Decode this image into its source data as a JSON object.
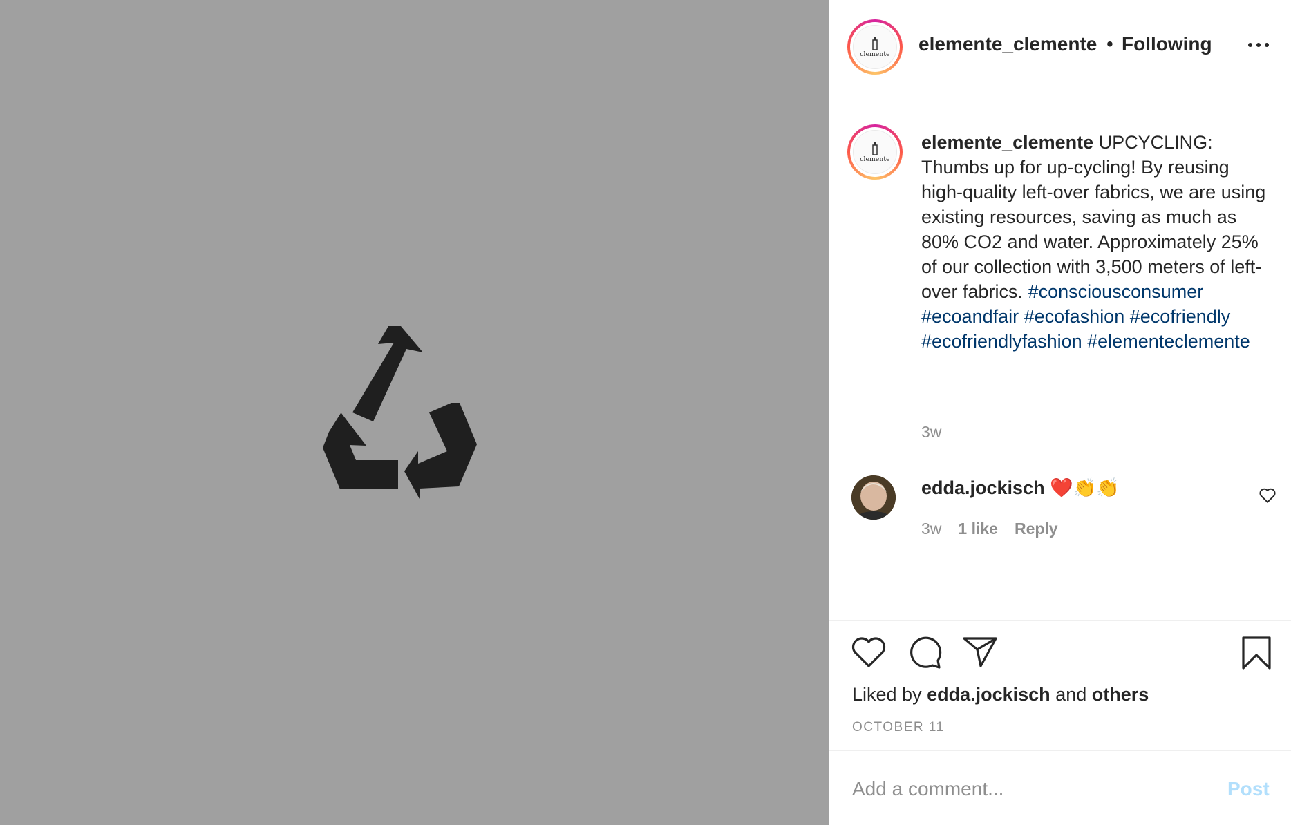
{
  "post": {
    "username": "elemente_clemente",
    "follow_separator": "•",
    "follow_status": "Following",
    "logo_text": "clemente",
    "caption_text": "UPCYCLING: Thumbs up for up-cycling! By reusing high-quality left-over fabrics, we are using existing resources, saving as much as 80% CO2 and water. Approximately 25% of our collection with 3,500 meters of left-over fabrics.",
    "hashtags": "#consciousconsumer #ecoandfair #ecofashion #ecofriendly #ecofriendlyfashion #elementeclemente",
    "caption_time": "3w"
  },
  "comments": [
    {
      "username": "edda.jockisch",
      "text": "❤️👏👏",
      "time": "3w",
      "likes": "1 like",
      "reply_label": "Reply"
    }
  ],
  "likes": {
    "prefix": "Liked by",
    "user": "edda.jockisch",
    "conjunction": "and",
    "others": "others"
  },
  "post_date": "OCTOBER 11",
  "add_comment": {
    "placeholder": "Add a comment...",
    "post_label": "Post"
  },
  "icons": {
    "media": "recycle-icon",
    "more": "more-icon",
    "like": "heart-icon",
    "comment": "comment-icon",
    "share": "paper-plane-icon",
    "save": "bookmark-icon"
  },
  "colors": {
    "media_background": "#a0a0a0",
    "recycle_symbol": "#1f1f1f",
    "hashtag": "#00376b",
    "muted_text": "#8e8e8e",
    "post_button_disabled": "#b2dffc"
  }
}
